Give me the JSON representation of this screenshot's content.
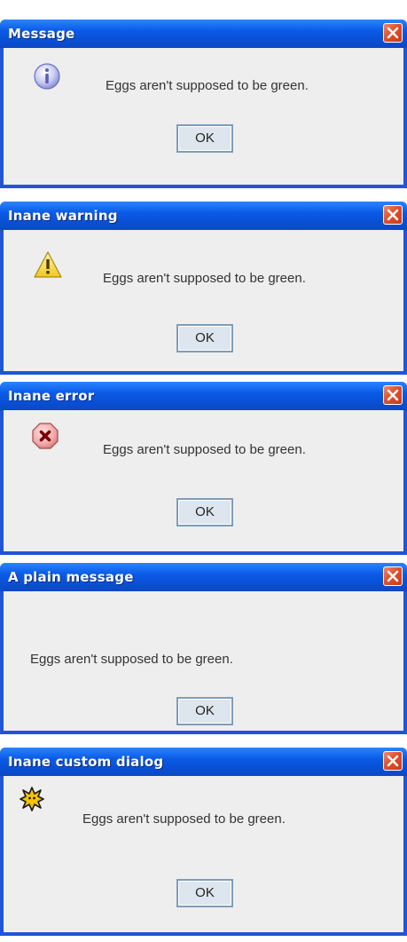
{
  "dialogs": [
    {
      "title": "Message",
      "icon": "information-icon",
      "message": "Eggs aren't supposed to be green.",
      "ok_label": "OK"
    },
    {
      "title": "Inane warning",
      "icon": "warning-icon",
      "message": "Eggs aren't supposed to be green.",
      "ok_label": "OK"
    },
    {
      "title": "Inane error",
      "icon": "error-icon",
      "message": "Eggs aren't supposed to be green.",
      "ok_label": "OK"
    },
    {
      "title": "A plain message",
      "icon": "",
      "message": "Eggs aren't supposed to be green.",
      "ok_label": "OK"
    },
    {
      "title": "Inane custom dialog",
      "icon": "custom-star-icon",
      "message": "Eggs aren't supposed to be green.",
      "ok_label": "OK"
    }
  ],
  "colors": {
    "titlebar": "#0a5ae6",
    "frame": "#1f55d6",
    "content_bg": "#eeeeee",
    "close_button": "#e0502c",
    "button_border": "#7f9db9"
  }
}
